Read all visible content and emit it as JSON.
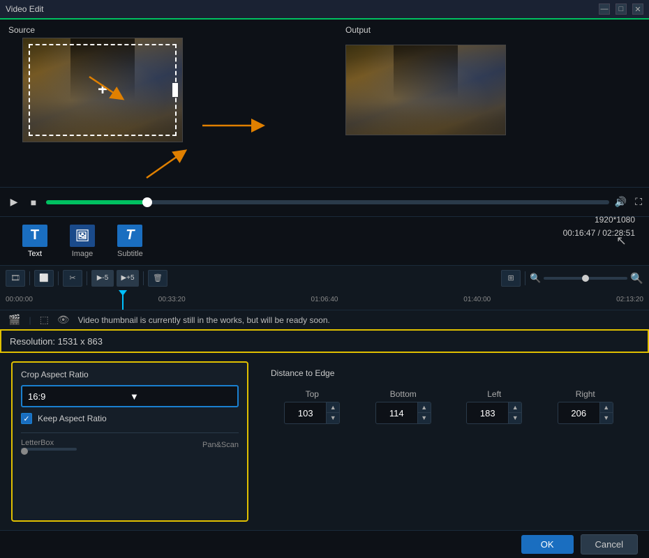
{
  "titlebar": {
    "title": "Video Edit",
    "minimize": "—",
    "maximize": "□",
    "close": "✕"
  },
  "preview": {
    "source_label": "Source",
    "output_label": "Output"
  },
  "resolution_display": {
    "res": "1920*1080",
    "time": "00:16:47 / 02:28:51"
  },
  "tools": {
    "text_label": "Text",
    "image_label": "Image",
    "subtitle_label": "Subtitle"
  },
  "toolbar": {
    "neg5": "▶-5",
    "pos5": "▶+5"
  },
  "timeline": {
    "marks": [
      "00:00:00",
      "00:33:20",
      "01:06:40",
      "01:40:00",
      "02:13:20"
    ]
  },
  "status": {
    "message": "Video thumbnail is currently still in the works, but will be ready soon."
  },
  "resolution_bar": {
    "text": "Resolution: 1531 x 863"
  },
  "crop": {
    "title": "Crop Aspect Ratio",
    "aspect_value": "16:9",
    "keep_ratio_label": "Keep Aspect Ratio",
    "letterbox_label": "LetterBox",
    "panscan_label": "Pan&Scan"
  },
  "distance": {
    "title": "Distance to Edge",
    "top_label": "Top",
    "bottom_label": "Bottom",
    "left_label": "Left",
    "right_label": "Right",
    "top_val": "103",
    "bottom_val": "114",
    "left_val": "183",
    "right_val": "206"
  },
  "bottom": {
    "ok_label": "OK",
    "cancel_label": "Cancel"
  }
}
